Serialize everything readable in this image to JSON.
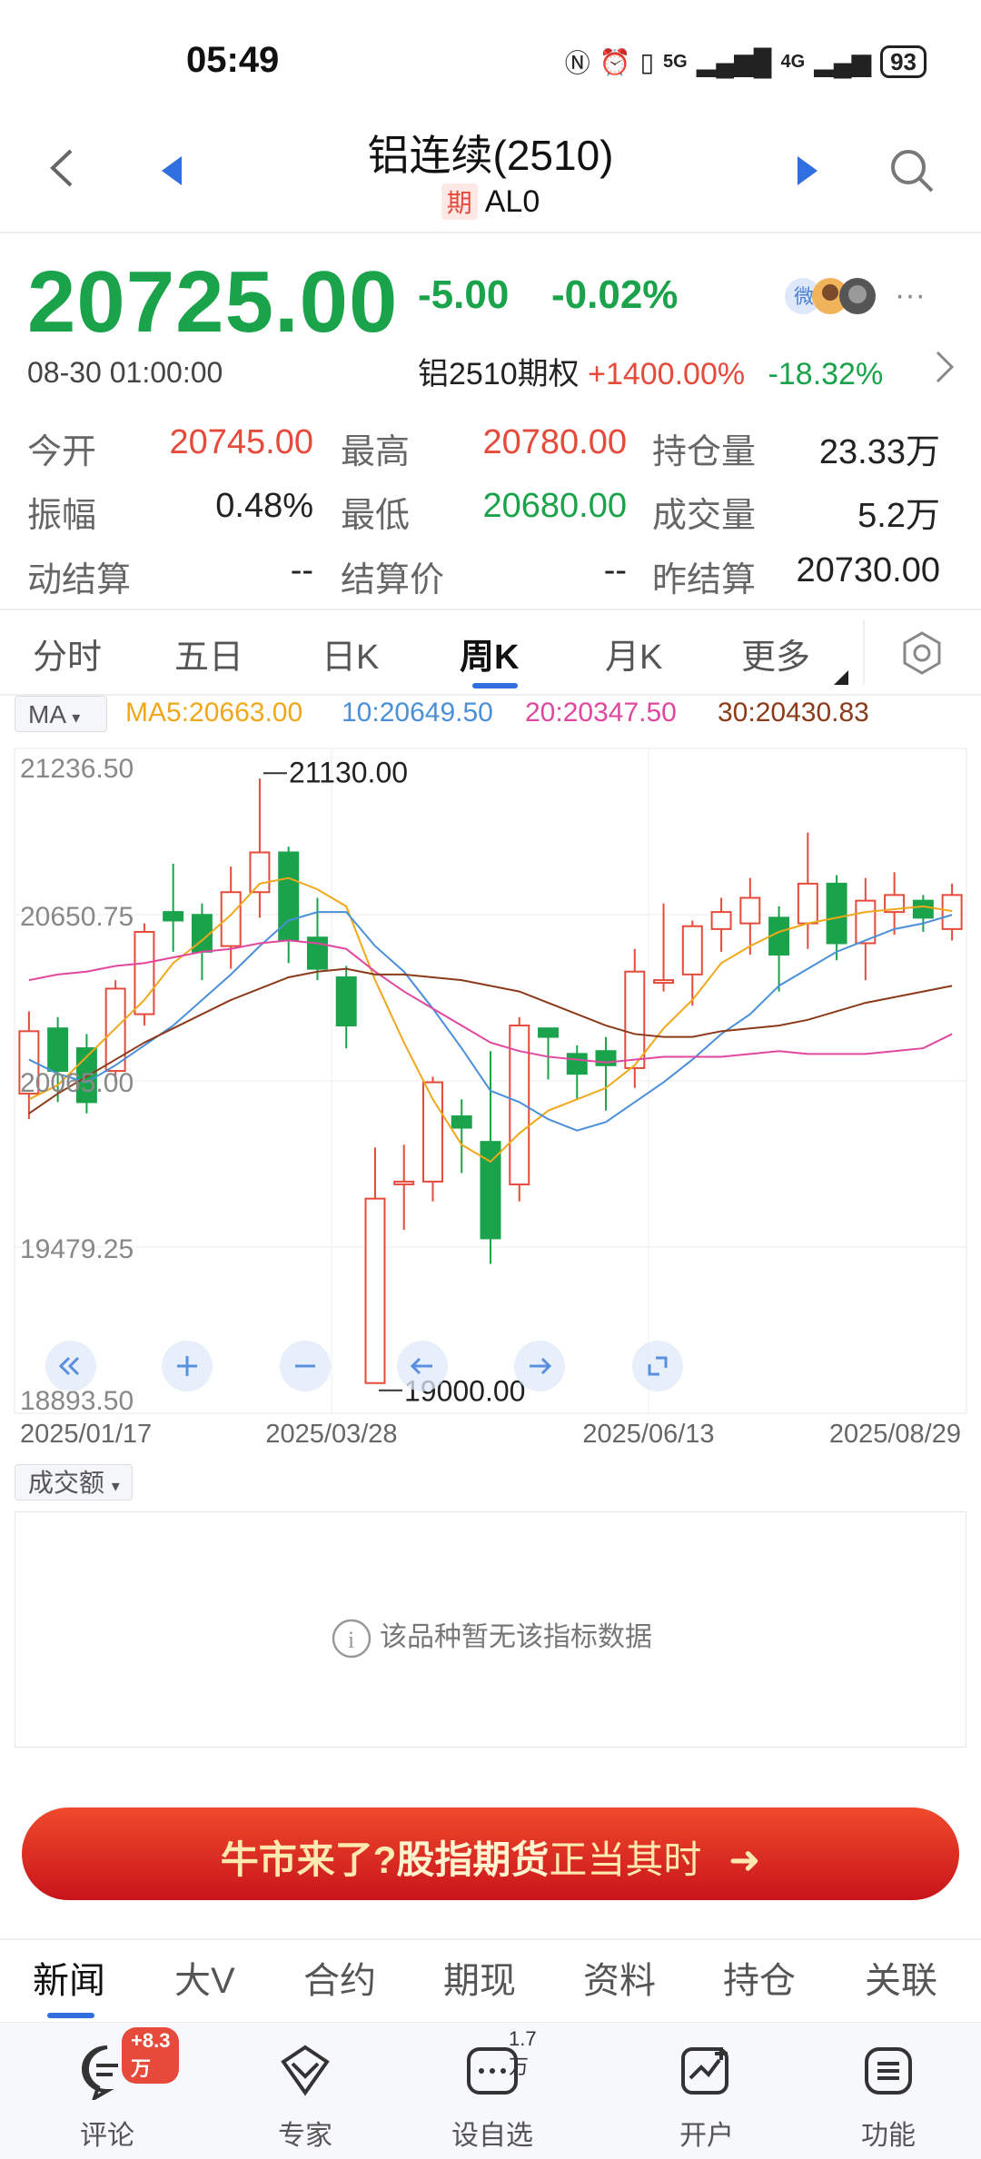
{
  "status": {
    "time": "05:49",
    "battery": "93",
    "net1": "5G",
    "net2": "4G"
  },
  "header": {
    "title": "铝连续(2510)",
    "badge": "期",
    "code": "AL0"
  },
  "quote": {
    "price": "20725.00",
    "change": "-5.00",
    "change_pct": "-0.02%",
    "time": "08-30 01:00:00",
    "option_label": "铝2510期权",
    "option_up": "+1400.00%",
    "option_down": "-18.32%"
  },
  "stats": [
    {
      "label": "今开",
      "value": "20745.00",
      "color": "red"
    },
    {
      "label": "最高",
      "value": "20780.00",
      "color": "red"
    },
    {
      "label": "持仓量",
      "value": "23.33万",
      "color": "dark"
    },
    {
      "label": "振幅",
      "value": "0.48%",
      "color": "dark"
    },
    {
      "label": "最低",
      "value": "20680.00",
      "color": "green"
    },
    {
      "label": "成交量",
      "value": "5.2万",
      "color": "dark"
    },
    {
      "label": "动结算",
      "value": "--",
      "color": "dark"
    },
    {
      "label": "结算价",
      "value": "--",
      "color": "dark"
    },
    {
      "label": "昨结算",
      "value": "20730.00",
      "color": "dark"
    }
  ],
  "ktabs": [
    "分时",
    "五日",
    "日K",
    "周K",
    "月K",
    "更多"
  ],
  "ma": {
    "selector": "MA",
    "ma5": "MA5:20663.00",
    "ma10": "10:20649.50",
    "ma20": "20:20347.50",
    "ma30": "30:20430.83"
  },
  "colors": {
    "up": "#e64a3b",
    "down": "#1aa34a",
    "ma5": "#f0a81a",
    "ma10": "#4a90d9",
    "ma20": "#e0479e",
    "ma30": "#8b3a1a"
  },
  "chart_data": {
    "type": "candlestick",
    "y_axis_labels": [
      "21236.50",
      "20650.75",
      "20065.00",
      "19479.25",
      "18893.50"
    ],
    "ylim": [
      18893.5,
      21236.5
    ],
    "x_labels": [
      "2025/01/17",
      "2025/03/28",
      "2025/06/13",
      "2025/08/29"
    ],
    "max_label": "21130.00",
    "min_label": "19000.00",
    "candles": [
      {
        "o": 20020,
        "c": 20240,
        "h": 20310,
        "l": 19930
      },
      {
        "o": 20250,
        "c": 20100,
        "h": 20290,
        "l": 19990
      },
      {
        "o": 20180,
        "c": 19990,
        "h": 20230,
        "l": 19950
      },
      {
        "o": 20100,
        "c": 20390,
        "h": 20420,
        "l": 20060
      },
      {
        "o": 20300,
        "c": 20590,
        "h": 20620,
        "l": 20260
      },
      {
        "o": 20660,
        "c": 20630,
        "h": 20830,
        "l": 20520
      },
      {
        "o": 20650,
        "c": 20520,
        "h": 20690,
        "l": 20420
      },
      {
        "o": 20540,
        "c": 20730,
        "h": 20820,
        "l": 20460
      },
      {
        "o": 20730,
        "c": 20870,
        "h": 21130,
        "l": 20640
      },
      {
        "o": 20870,
        "c": 20560,
        "h": 20890,
        "l": 20480
      },
      {
        "o": 20570,
        "c": 20460,
        "h": 20710,
        "l": 20420
      },
      {
        "o": 20430,
        "c": 20260,
        "h": 20470,
        "l": 20180
      },
      {
        "o": 19000,
        "c": 19650,
        "h": 19830,
        "l": 19000
      },
      {
        "o": 19710,
        "c": 19710,
        "h": 19840,
        "l": 19540
      },
      {
        "o": 19710,
        "c": 20060,
        "h": 20080,
        "l": 19640
      },
      {
        "o": 19940,
        "c": 19900,
        "h": 20000,
        "l": 19740
      },
      {
        "o": 19850,
        "c": 19510,
        "h": 20170,
        "l": 19420
      },
      {
        "o": 19700,
        "c": 20260,
        "h": 20290,
        "l": 19640
      },
      {
        "o": 20250,
        "c": 20220,
        "h": 20250,
        "l": 20070
      },
      {
        "o": 20160,
        "c": 20090,
        "h": 20190,
        "l": 20000
      },
      {
        "o": 20170,
        "c": 20120,
        "h": 20220,
        "l": 19960
      },
      {
        "o": 20110,
        "c": 20450,
        "h": 20530,
        "l": 20040
      },
      {
        "o": 20420,
        "c": 20420,
        "h": 20690,
        "l": 20380
      },
      {
        "o": 20440,
        "c": 20610,
        "h": 20630,
        "l": 20330
      },
      {
        "o": 20600,
        "c": 20660,
        "h": 20710,
        "l": 20520
      },
      {
        "o": 20620,
        "c": 20710,
        "h": 20780,
        "l": 20510
      },
      {
        "o": 20640,
        "c": 20510,
        "h": 20680,
        "l": 20380
      },
      {
        "o": 20620,
        "c": 20760,
        "h": 20940,
        "l": 20530
      },
      {
        "o": 20760,
        "c": 20550,
        "h": 20790,
        "l": 20490
      },
      {
        "o": 20550,
        "c": 20700,
        "h": 20780,
        "l": 20420
      },
      {
        "o": 20660,
        "c": 20720,
        "h": 20800,
        "l": 20580
      },
      {
        "o": 20700,
        "c": 20640,
        "h": 20720,
        "l": 20590
      },
      {
        "o": 20600,
        "c": 20720,
        "h": 20760,
        "l": 20560
      }
    ],
    "ma5": [
      20000,
      20050,
      20150,
      20250,
      20350,
      20480,
      20560,
      20650,
      20760,
      20780,
      20740,
      20680,
      20420,
      20200,
      20000,
      19840,
      19780,
      19880,
      19960,
      20000,
      20040,
      20120,
      20250,
      20350,
      20480,
      20540,
      20590,
      20620,
      20640,
      20660,
      20670,
      20680,
      20663
    ],
    "ma10": [
      20140,
      20090,
      20060,
      20120,
      20190,
      20260,
      20350,
      20440,
      20540,
      20630,
      20660,
      20660,
      20540,
      20450,
      20320,
      20180,
      20030,
      19990,
      19930,
      19890,
      19920,
      19990,
      20060,
      20140,
      20230,
      20300,
      20400,
      20460,
      20520,
      20560,
      20600,
      20620,
      20650
    ],
    "ma20": [
      20420,
      20440,
      20450,
      20470,
      20480,
      20500,
      20520,
      20530,
      20550,
      20560,
      20550,
      20530,
      20450,
      20380,
      20320,
      20260,
      20200,
      20170,
      20150,
      20140,
      20130,
      20140,
      20150,
      20150,
      20150,
      20160,
      20170,
      20160,
      20160,
      20160,
      20170,
      20180,
      20230
    ],
    "ma30": [
      19950,
      20020,
      20080,
      20140,
      20200,
      20250,
      20300,
      20350,
      20390,
      20430,
      20450,
      20460,
      20440,
      20440,
      20430,
      20420,
      20400,
      20380,
      20340,
      20300,
      20260,
      20230,
      20220,
      20220,
      20240,
      20250,
      20260,
      20280,
      20310,
      20340,
      20360,
      20380,
      20400
    ]
  },
  "tools": [
    "double-left-icon",
    "zoom-in-icon",
    "zoom-out-icon",
    "arrow-left-icon",
    "arrow-right-icon",
    "fullscreen-icon"
  ],
  "volume": {
    "selector": "成交额",
    "empty_text": "该品种暂无该指标数据"
  },
  "banner": {
    "part1": "牛市来了?",
    "part2": "股指期货",
    "part3": "正当其时",
    "arrow": "➜"
  },
  "news_tabs": [
    "新闻",
    "大V",
    "合约",
    "期现",
    "资料",
    "持仓",
    "关联"
  ],
  "bottom_nav": [
    {
      "label": "评论",
      "badge": "+8.3万"
    },
    {
      "label": "专家",
      "badge": ""
    },
    {
      "label": "设自选",
      "badge": "1.7万"
    },
    {
      "label": "开户",
      "badge": ""
    },
    {
      "label": "功能",
      "badge": ""
    }
  ]
}
